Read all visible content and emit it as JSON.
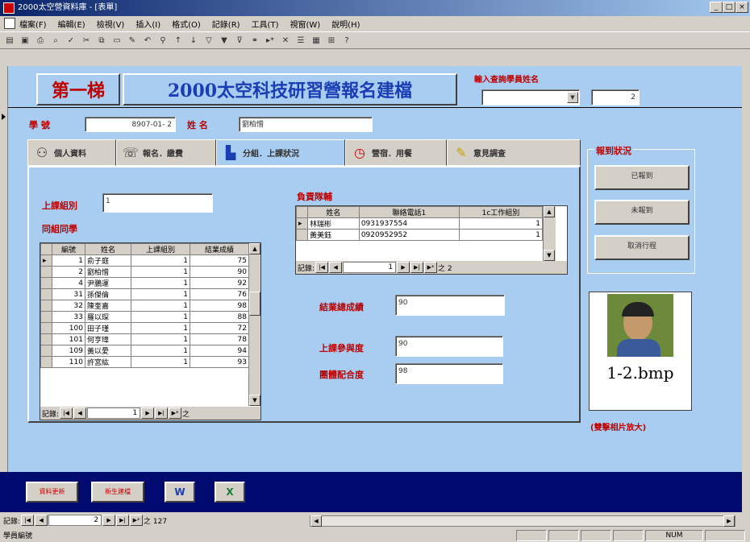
{
  "window": {
    "title": "2000太空營資料庫 - [表單]",
    "min": "_",
    "max": "□",
    "close": "×"
  },
  "menu": [
    "檔案(F)",
    "編輯(E)",
    "檢視(V)",
    "插入(I)",
    "格式(O)",
    "記錄(R)",
    "工具(T)",
    "視窗(W)",
    "說明(H)"
  ],
  "header": {
    "step": "第一梯",
    "title": "2000太空科技研習營報名建檔",
    "search_label": "輸入查詢學員姓名",
    "search_value": "",
    "count_value": "2"
  },
  "student": {
    "id_label": "學 號",
    "id_value": "8907-01- 2",
    "name_label": "姓 名",
    "name_value": "劉柏憎"
  },
  "tabs": [
    {
      "label": "個人資料",
      "icon": "person-icon"
    },
    {
      "label": "報名．繳費",
      "icon": "phone-icon"
    },
    {
      "label": "分組．上課狀況",
      "icon": "chart-icon"
    },
    {
      "label": "營宿．用餐",
      "icon": "clock-icon"
    },
    {
      "label": "意見調查",
      "icon": "pencil-icon"
    }
  ],
  "group": {
    "class_label": "上課組別",
    "class_value": "1",
    "classmates_label": "同組同學",
    "columns": [
      "編號",
      "姓名",
      "上課組別",
      "結業成績"
    ],
    "rows": [
      [
        "1",
        "俞子庭",
        "1",
        "75"
      ],
      [
        "2",
        "劉柏憎",
        "1",
        "90"
      ],
      [
        "4",
        "尹鵬運",
        "1",
        "92"
      ],
      [
        "31",
        "孫傑倫",
        "1",
        "76"
      ],
      [
        "32",
        "陳奎嘉",
        "1",
        "98"
      ],
      [
        "33",
        "羅以琛",
        "1",
        "88"
      ],
      [
        "100",
        "田子瑾",
        "1",
        "72"
      ],
      [
        "101",
        "何亨瑋",
        "1",
        "78"
      ],
      [
        "109",
        "黃以愛",
        "1",
        "94"
      ],
      [
        "110",
        "許宮紘",
        "1",
        "93"
      ]
    ],
    "nav_label": "記錄:",
    "nav_value": "1",
    "nav_of": "之"
  },
  "counselor": {
    "label": "負責隊輔",
    "columns": [
      "姓名",
      "聯絡電話1",
      "1c工作組別"
    ],
    "rows": [
      [
        "林瑞彬",
        "0931937554",
        "1"
      ],
      [
        "黃美鈺",
        "0920952952",
        "1"
      ]
    ],
    "nav_label": "記錄:",
    "nav_value": "1",
    "nav_of": "之 2"
  },
  "scores": {
    "final_label": "結業總成績",
    "final_value": "90",
    "participation_label": "上課參與度",
    "participation_value": "90",
    "teamwork_label": "團體配合度",
    "teamwork_value": "98"
  },
  "checkin": {
    "label": "報到狀況",
    "btn1": "已報到",
    "btn2": "未報到",
    "btn3": "取消行程"
  },
  "photo": {
    "filename": "1-2.bmp",
    "hint": "(雙擊相片放大)"
  },
  "footer": {
    "btn_update": "資料更新",
    "btn_new": "新生建檔",
    "word_icon": "W",
    "excel_icon": "X"
  },
  "record_nav": {
    "label": "記錄:",
    "value": "2",
    "of": "之 127"
  },
  "status": {
    "text": "學員編號",
    "mode": "NUM"
  }
}
